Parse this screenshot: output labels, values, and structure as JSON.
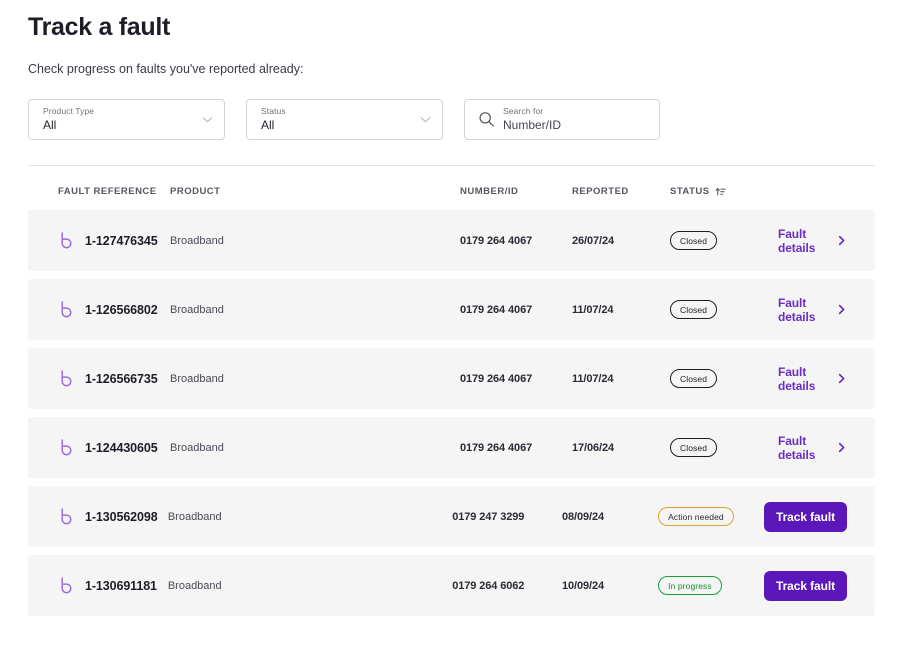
{
  "header": {
    "title": "Track a fault",
    "subtitle": "Check progress on faults you've reported already:"
  },
  "filters": {
    "product_type": {
      "label": "Product Type",
      "value": "All",
      "icon": "chevron-down-icon"
    },
    "status": {
      "label": "Status",
      "value": "All",
      "icon": "chevron-down-icon"
    },
    "search": {
      "label": "Search for",
      "placeholder": "Number/ID",
      "value": "",
      "icon": "search-icon"
    }
  },
  "table": {
    "columns": {
      "fault_reference": "FAULT REFERENCE",
      "product": "PRODUCT",
      "number_id": "NUMBER/ID",
      "reported": "REPORTED",
      "status": "STATUS"
    },
    "sort": {
      "column": "STATUS",
      "icon": "sort-ascending-icon"
    },
    "rows": [
      {
        "icon": "broadband-icon",
        "reference": "1-127476345",
        "product": "Broadband",
        "number_id": "0179 264 4067",
        "reported": "26/07/24",
        "status": "Closed",
        "status_variant": "closed",
        "action_type": "link",
        "action_label": "Fault details"
      },
      {
        "icon": "broadband-icon",
        "reference": "1-126566802",
        "product": "Broadband",
        "number_id": "0179 264 4067",
        "reported": "11/07/24",
        "status": "Closed",
        "status_variant": "closed",
        "action_type": "link",
        "action_label": "Fault details"
      },
      {
        "icon": "broadband-icon",
        "reference": "1-126566735",
        "product": "Broadband",
        "number_id": "0179 264 4067",
        "reported": "11/07/24",
        "status": "Closed",
        "status_variant": "closed",
        "action_type": "link",
        "action_label": "Fault details"
      },
      {
        "icon": "broadband-icon",
        "reference": "1-124430605",
        "product": "Broadband",
        "number_id": "0179 264 4067",
        "reported": "17/06/24",
        "status": "Closed",
        "status_variant": "closed",
        "action_type": "link",
        "action_label": "Fault details"
      },
      {
        "icon": "broadband-icon",
        "reference": "1-130562098",
        "product": "Broadband",
        "number_id": "0179 247 3299",
        "reported": "08/09/24",
        "status": "Action needed",
        "status_variant": "amber",
        "action_type": "button",
        "action_label": "Track fault"
      },
      {
        "icon": "broadband-icon",
        "reference": "1-130691181",
        "product": "Broadband",
        "number_id": "0179 264 6062",
        "reported": "10/09/24",
        "status": "In progress",
        "status_variant": "green",
        "action_type": "button",
        "action_label": "Track fault"
      }
    ]
  },
  "colors": {
    "brand_purple": "#5b17ba",
    "link_purple": "#6b2ec4",
    "icon_purple": "#9a6ede",
    "status_amber": "#e0a12e",
    "status_green": "#17a138",
    "row_background": "#f5f5f5"
  }
}
